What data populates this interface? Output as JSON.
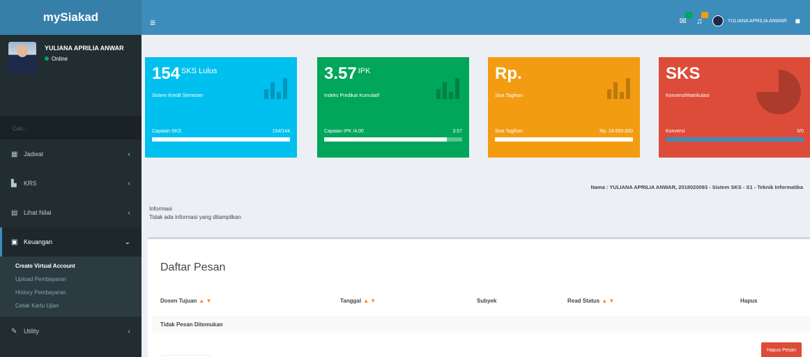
{
  "brand": "mySiakad",
  "user": {
    "name": "YULIANA APRILIA ANWAR",
    "status": "Online"
  },
  "sidebar": {
    "search_label": "Cari...",
    "items": [
      {
        "label": "Jadwal",
        "icon": "calendar-icon"
      },
      {
        "label": "KRS",
        "icon": "file-icon"
      },
      {
        "label": "Lihat Nilai",
        "icon": "table-icon"
      },
      {
        "label": "Keuangan",
        "icon": "money-icon"
      },
      {
        "label": "Utility",
        "icon": "wrench-icon"
      }
    ],
    "submenu": [
      "Create Virtual Account",
      "Upload Pembayaran",
      "History Pembayaran",
      "Cetak Kartu Ujian"
    ]
  },
  "header": {
    "user_name": "YULIANA APRILIA ANWAR"
  },
  "boxes": [
    {
      "value": "154",
      "sup": "SKS Lulus",
      "desc": "Sistem Kredit Semester",
      "prog_label": "Capaian SKS",
      "prog_value": "154/144",
      "progress": 1.0,
      "color": "#00c0ef"
    },
    {
      "value": "3.57",
      "sup": "IPK",
      "desc": "Indeks Predikat Kumulatif",
      "prog_label": "Capaian IPK /4.00",
      "prog_value": "3.57",
      "progress": 0.89,
      "color": "#00a65a"
    },
    {
      "value": "Rp.",
      "sup": "",
      "desc": "Sisa Tagihan",
      "prog_label": "Sisa Tagihan",
      "prog_value": "Rp. 24.650.000",
      "progress": 1.0,
      "color": "#f39c12"
    },
    {
      "value": "SKS",
      "sup": "",
      "desc": "Konversi/Matrikulasi",
      "prog_label": "Konversi",
      "prog_value": "0/0",
      "progress": 1.0,
      "color": "#dd4b39"
    }
  ],
  "info_line": "Nama : YULIANA APRILIA ANWAR,  2018020093 - Sistem SKS  - S1 - Teknik Informatika",
  "informasi": {
    "title": "Informasi",
    "text": "Tidak ada informasi yang ditampilkan"
  },
  "panel": {
    "title": "Daftar Pesan",
    "columns": [
      "Dosen Tujuan",
      "Tanggal",
      "Subyek",
      "Read Status",
      "Hapus"
    ],
    "sort_glyph": "▲ ▼",
    "empty_text": "Tidak Pesan Ditemukan",
    "delete_button": "Hapus Pesan"
  }
}
